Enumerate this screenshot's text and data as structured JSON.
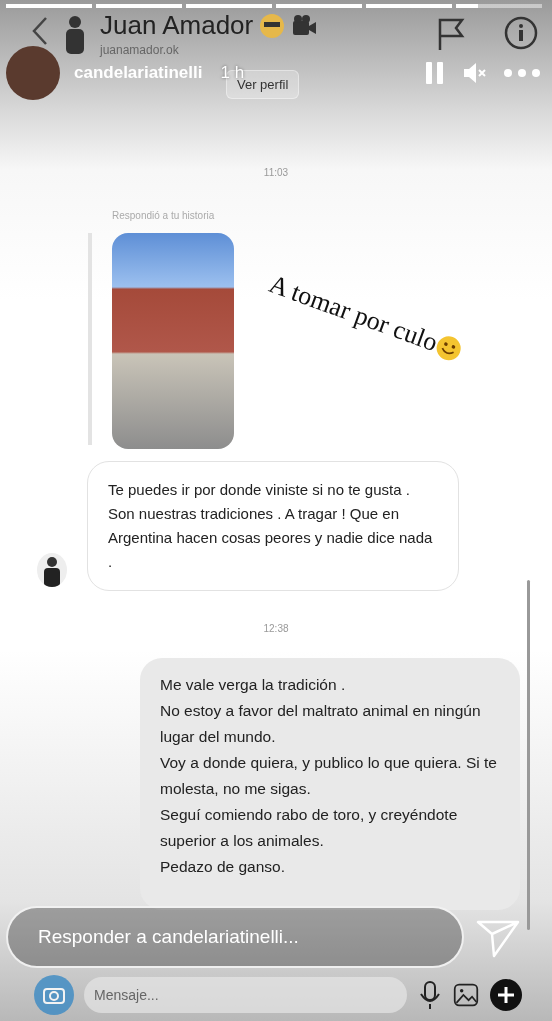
{
  "dm_header": {
    "name": "Juan Amador",
    "username": "juanamador.ok",
    "profile_button": "Ver perfil"
  },
  "story_progress": [
    {
      "level": 1
    },
    {
      "level": 1
    },
    {
      "level": 1
    },
    {
      "level": 1
    },
    {
      "level": 1
    },
    {
      "level": 0.25
    }
  ],
  "story_header": {
    "username": "candelariatinelli",
    "time": "1 h"
  },
  "conversation": {
    "time_1": "11:03",
    "reply_note": "Respondió a tu historia",
    "sticker_text": "A tomar por culo",
    "received_message": "Te puedes ir por donde viniste si no te gusta . Son nuestras tradiciones . A tragar ! Que en Argentina hacen cosas peores y nadie dice nada .",
    "time_2": "12:38",
    "sent_message": "Me vale verga la tradición .\nNo estoy a favor del maltrato animal en ningún lugar del mundo.\nVoy a donde quiera, y publico lo que quiera. Si te molesta, no me sigas.\nSeguí comiendo rabo de toro, y creyéndote superior a los animales.\nPedazo de ganso."
  },
  "composer": {
    "placeholder": "Mensaje..."
  },
  "story_reply": {
    "placeholder": "Responder a candelariatinelli..."
  }
}
